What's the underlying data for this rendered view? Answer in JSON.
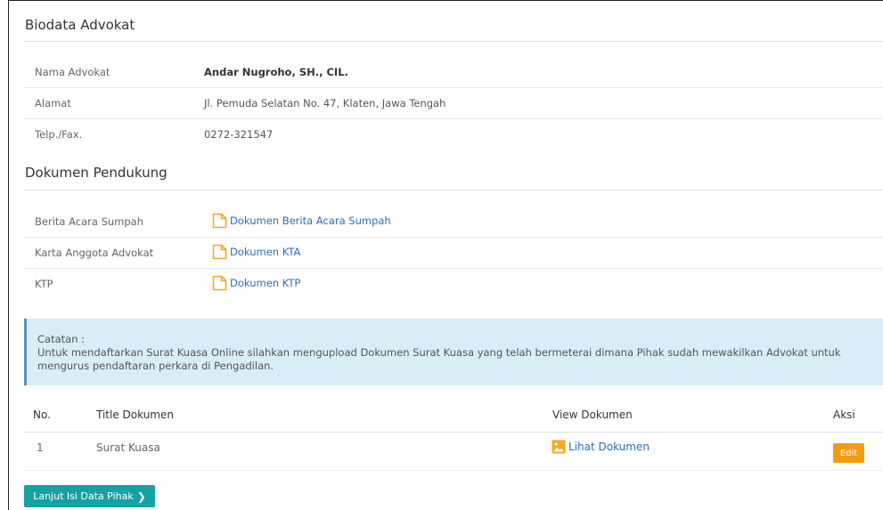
{
  "biodata": {
    "title": "Biodata Advokat",
    "rows": [
      {
        "label": "Nama Advokat",
        "value": "Andar Nugroho, SH., CIL."
      },
      {
        "label": "Alamat",
        "value": "Jl. Pemuda Selatan No. 47, Klaten, Jawa Tengah"
      },
      {
        "label": "Telp./Fax.",
        "value": "0272-321547"
      }
    ]
  },
  "dokumen": {
    "title": "Dokumen Pendukung",
    "rows": [
      {
        "label": "Berita Acara Sumpah",
        "link": "Dokumen Berita Acara Sumpah"
      },
      {
        "label": "Karta Anggota Advokat",
        "link": "Dokumen KTA"
      },
      {
        "label": "KTP",
        "link": "Dokumen KTP"
      }
    ]
  },
  "note": {
    "title": "Catatan :",
    "text": "Untuk mendaftarkan Surat Kuasa Online silahkan mengupload Dokumen Surat Kuasa yang telah bermeterai dimana Pihak sudah mewakilkan Advokat untuk mengurus pendaftaran perkara di Pengadilan."
  },
  "table": {
    "headers": [
      "No.",
      "Title Dokumen",
      "View Dokumen",
      "Aksi"
    ],
    "rows": [
      {
        "no": "1",
        "title": "Surat Kuasa",
        "view": "Lihat Dokumen",
        "action": "Edit"
      }
    ]
  },
  "next_button": "Lanjut Isi Data Pihak",
  "colors": {
    "link": "#2a6ebb",
    "icon": "#f5a623",
    "edit": "#f39c12",
    "next": "#17a2a2",
    "note_bg": "#d9edf7"
  }
}
